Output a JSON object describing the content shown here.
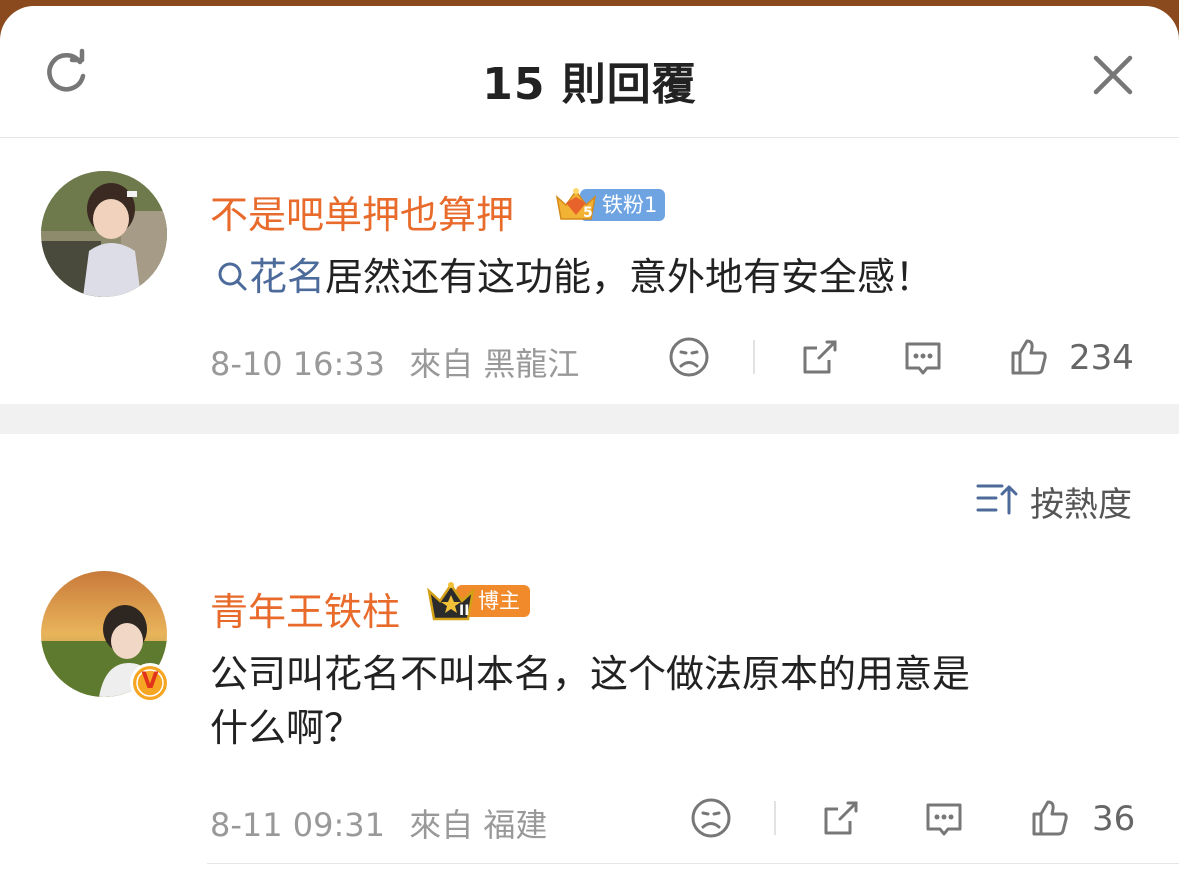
{
  "header": {
    "title": "15 則回覆"
  },
  "post": {
    "username": "不是吧单押也算押",
    "badge_label": "铁粉1",
    "badge_level": "5",
    "topic": "花名",
    "text": "居然还有这功能，意外地有安全感！",
    "time": "8-10 16:33",
    "location": "來自 黑龍江",
    "likes": "234"
  },
  "sort": {
    "label": "按熱度"
  },
  "reply": {
    "username": "青年王铁柱",
    "badge_label": "博主",
    "badge_level": "II",
    "verified_mark": "V",
    "text_line1": "公司叫花名不叫本名，这个做法原本的用意是",
    "text_line2": "什么啊？",
    "time": "8-11 09:31",
    "location": "來自 福建",
    "likes": "36"
  },
  "colors": {
    "username": "#e86b2c",
    "link": "#4c6a9a",
    "fan_badge": "#6fa4e3",
    "blogger_badge": "#f08a2b",
    "verified": "#f6a623"
  },
  "icons": [
    "refresh-icon",
    "close-icon",
    "search-icon",
    "sad-face-icon",
    "share-icon",
    "comment-icon",
    "like-icon",
    "sort-icon",
    "crown-icon"
  ]
}
